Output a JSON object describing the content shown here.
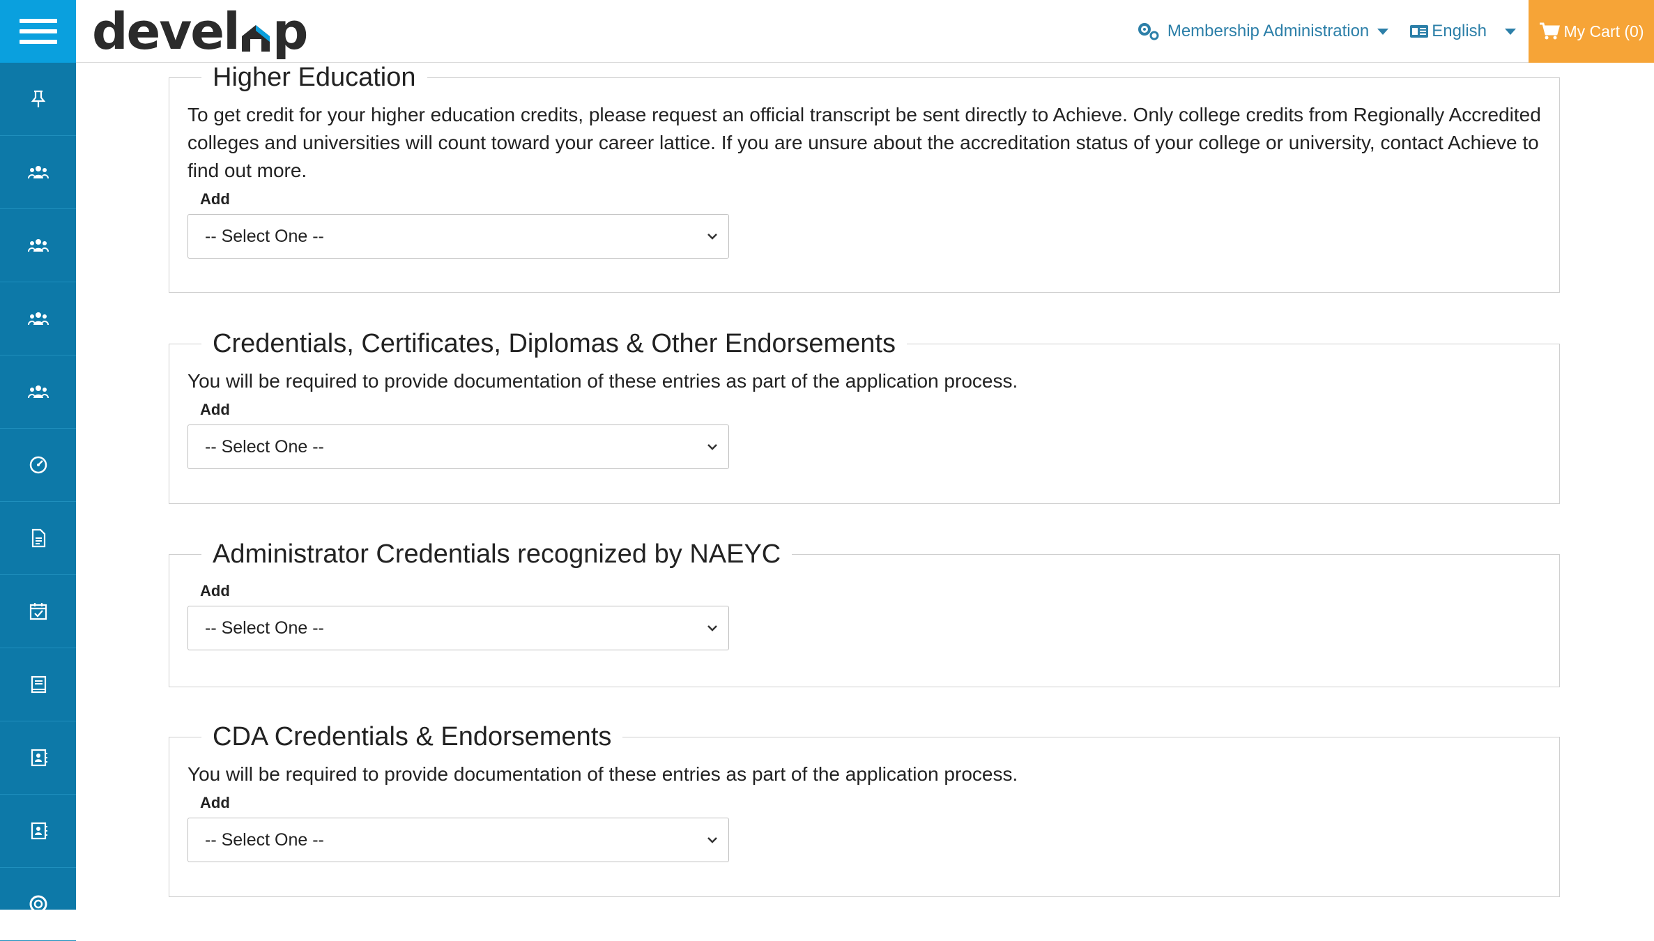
{
  "header": {
    "logo_left": "devel",
    "logo_right": "p",
    "membership_admin": "Membership Administration",
    "language": "English",
    "cart": "My Cart (0)",
    "colors": {
      "accent_blue": "#0aa0de",
      "sidebar": "#0d79a8",
      "cart_orange": "#f6a437",
      "link": "#2c7fa8"
    }
  },
  "sidebar": {
    "items": [
      {
        "icon": "pin-icon"
      },
      {
        "icon": "users-icon"
      },
      {
        "icon": "users-icon"
      },
      {
        "icon": "users-icon"
      },
      {
        "icon": "users-icon"
      },
      {
        "icon": "dashboard-icon"
      },
      {
        "icon": "document-icon"
      },
      {
        "icon": "calendar-check-icon"
      },
      {
        "icon": "book-icon"
      },
      {
        "icon": "contact-card-icon"
      },
      {
        "icon": "contact-card-icon"
      },
      {
        "icon": "lifebuoy-icon"
      }
    ]
  },
  "sections": [
    {
      "title": "Higher Education",
      "description": "To get credit for your higher education credits, please request an official transcript be sent directly to Achieve. Only college credits from Regionally Accredited colleges and universities will count toward your career lattice. If you are unsure about the accreditation status of your college or university, contact Achieve to find out more.",
      "add_label": "Add",
      "select_value": "-- Select One --"
    },
    {
      "title": "Credentials, Certificates, Diplomas & Other Endorsements",
      "description": "You will be required to provide documentation of these entries as part of the application process.",
      "add_label": "Add",
      "select_value": "-- Select One --"
    },
    {
      "title": "Administrator Credentials recognized by NAEYC",
      "description": "",
      "add_label": "Add",
      "select_value": "-- Select One --"
    },
    {
      "title": "CDA Credentials & Endorsements",
      "description": "You will be required to provide documentation of these entries as part of the application process.",
      "add_label": "Add",
      "select_value": "-- Select One --"
    }
  ]
}
